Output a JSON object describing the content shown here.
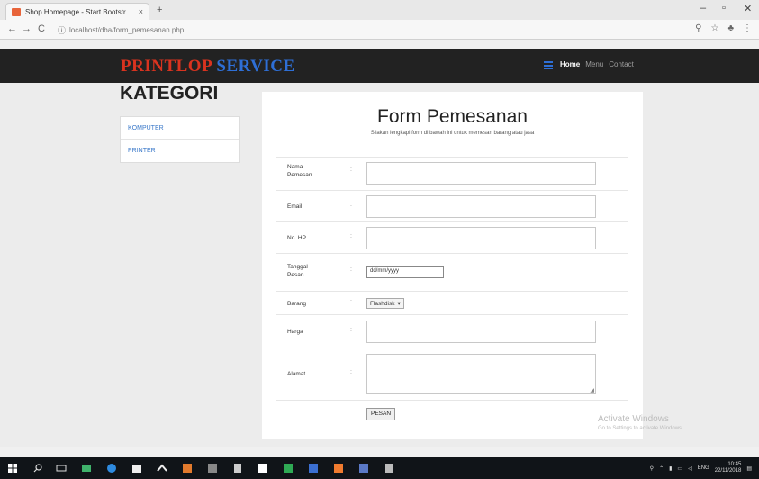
{
  "browser": {
    "tab_title": "Shop Homepage - Start Bootstr...",
    "tab_close": "×",
    "new_tab": "+",
    "url": "localhost/dba/form_pemesanan.php",
    "window_controls": [
      "–",
      "▫",
      "✕"
    ]
  },
  "navbar": {
    "brand_part1": "PRINTLOP",
    "brand_part2": "SERVICE",
    "links": [
      "Home",
      "Menu",
      "Contact"
    ]
  },
  "sidebar": {
    "heading": "KATEGORI",
    "items": [
      "KOMPUTER",
      "PRINTER"
    ]
  },
  "form": {
    "title": "Form Pemesanan",
    "subtitle": "Silakan lengkapi form di bawah ini untuk memesan barang atau jasa",
    "colon": ":",
    "fields": {
      "nama_label_1": "Nama",
      "nama_label_2": "Pemesan",
      "email_label": "Email",
      "nohp_label": "No. HP",
      "tanggal_label_1": "Tanggal",
      "tanggal_label_2": "Pesan",
      "tanggal_value": "dd/mm/yyyy",
      "barang_label": "Barang",
      "barang_selected": "Flashdisk",
      "harga_label": "Harga",
      "alamat_label": "Alamat"
    },
    "submit_label": "PESAN"
  },
  "watermark": {
    "line1": "Activate Windows",
    "line2": "Go to Settings to activate Windows."
  },
  "taskbar": {
    "time": "10:45",
    "date": "22/11/2018",
    "lang": "ENG"
  }
}
